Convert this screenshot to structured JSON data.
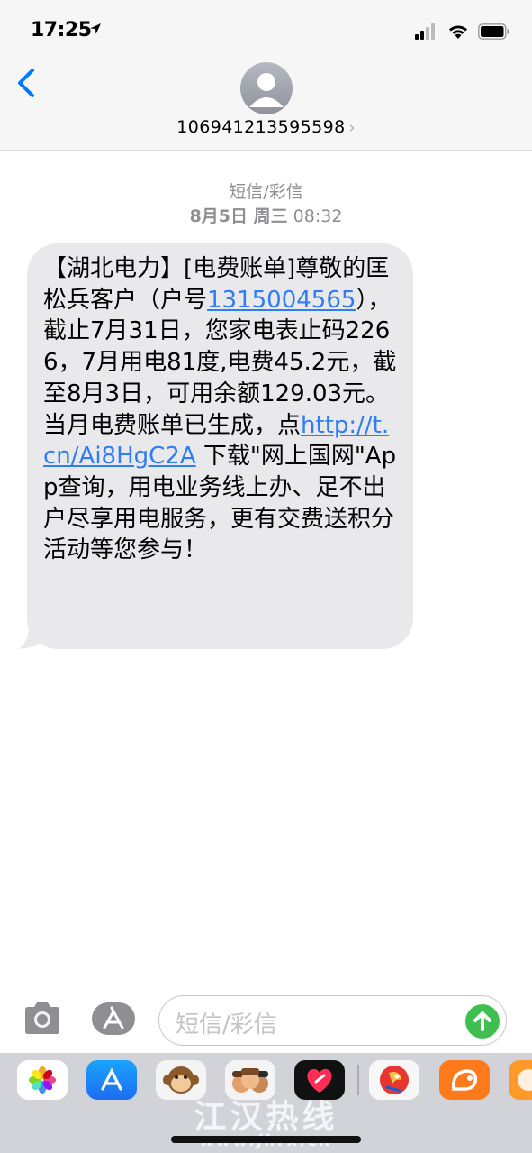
{
  "status_bar": {
    "time": "17:25",
    "icons": [
      "location-arrow-icon",
      "cellular-signal-icon",
      "wifi-icon",
      "battery-icon"
    ]
  },
  "header": {
    "back_icon": "chevron-left-icon",
    "avatar_icon": "person-silhouette-icon",
    "contact_number": "106941213595598",
    "contact_chevron": "›"
  },
  "thread": {
    "service_label": "短信/彩信",
    "date_bold": "8月5日 周三",
    "time": "08:32"
  },
  "message": {
    "part1": "【湖北电力】[电费账单]尊敬的匡松兵客户（户号",
    "account_link": "1315004565",
    "part2": "），截止7月31日，您家电表止码2266，7月用电81度,电费45.2元，截至8月3日，可用余额129.03元。当月电费账单已生成，点",
    "url_link": "http://t.cn/Ai8HgC2A",
    "part3": "下载\"网上国网\"App查询，用电业务线上办、足不出户尽享用电服务，更有交费送积分活动等您参与！"
  },
  "composer": {
    "camera_icon": "camera-icon",
    "appstore_icon": "app-store-icon",
    "placeholder": "短信/彩信",
    "send_icon": "arrow-up-icon"
  },
  "app_drawer": {
    "apps": [
      "photos-icon",
      "app-store-icon",
      "memoji-monkey-icon",
      "memoji-group-icon",
      "digital-touch-heart-icon",
      "parrot-app-icon",
      "uc-browser-icon",
      "orange-app-icon"
    ]
  },
  "watermark": {
    "title": "江汉热线",
    "url": "www.jhrx.cn"
  },
  "colors": {
    "bubble": "#e9e9eb",
    "link": "#2f7df6",
    "ios_blue": "#007aff",
    "send_green": "#3fbf4f",
    "header_bg": "#f6f6f6",
    "drawer_bg": "#d1d3d9"
  }
}
